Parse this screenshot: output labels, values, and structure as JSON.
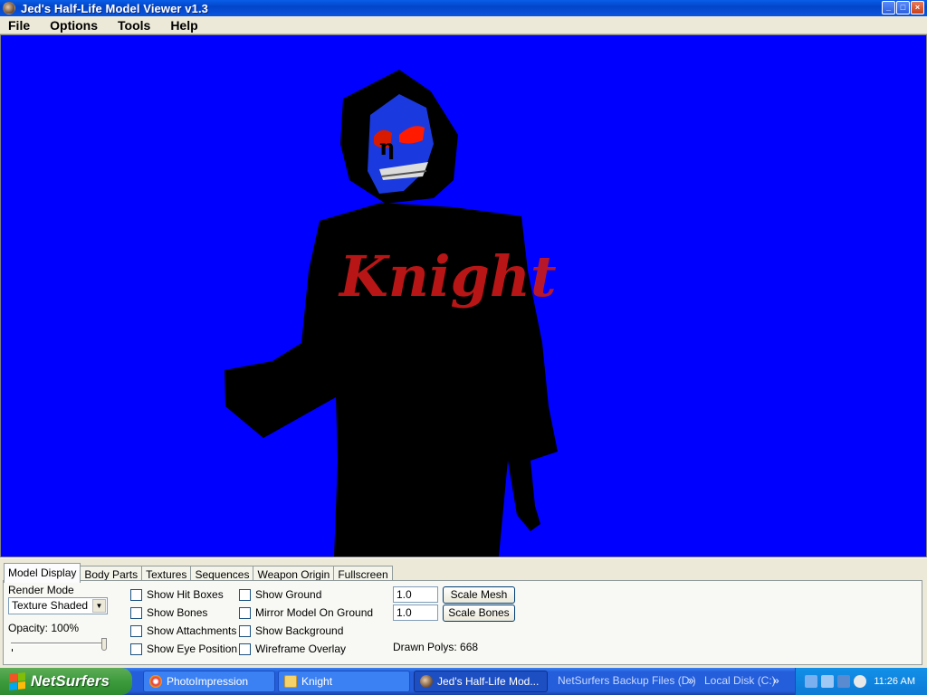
{
  "window": {
    "title": "Jed's Half-Life Model Viewer v1.3",
    "controls": [
      "_",
      "□",
      "×"
    ]
  },
  "menu": [
    "File",
    "Options",
    "Tools",
    "Help"
  ],
  "viewport": {
    "background": "#0000ff",
    "model_text": "Knight"
  },
  "tabs": [
    "Model Display",
    "Body Parts",
    "Textures",
    "Sequences",
    "Weapon Origin",
    "Fullscreen"
  ],
  "model_display": {
    "render_mode_label": "Render Mode",
    "render_mode_value": "Texture Shaded",
    "opacity_label": "Opacity: 100%",
    "opacity": 1.0,
    "checkboxes_col1": [
      "Show Hit Boxes",
      "Show Bones",
      "Show Attachments",
      "Show Eye Position"
    ],
    "checkboxes_col2": [
      "Show Ground",
      "Mirror Model On Ground",
      "Show Background",
      "Wireframe Overlay"
    ],
    "scale_mesh_value": "1.0",
    "scale_bones_value": "1.0",
    "scale_mesh_button": "Scale Mesh",
    "scale_bones_button": "Scale Bones",
    "drawn_polys": "Drawn Polys: 668"
  },
  "taskbar": {
    "start_label": "NetSurfers",
    "tasks": [
      "PhotoImpression",
      "Knight",
      "Jed's Half-Life Mod..."
    ],
    "quick_links": [
      "NetSurfers Backup Files (D:)",
      "Local Disk (C:)"
    ],
    "clock": "11:26 AM"
  },
  "colors": {
    "title_blue": "#0a55df",
    "viewport_blue": "#0000ff",
    "taskbar_blue": "#245edb",
    "start_green": "#3c9b3c",
    "text_red": "#c81818"
  }
}
